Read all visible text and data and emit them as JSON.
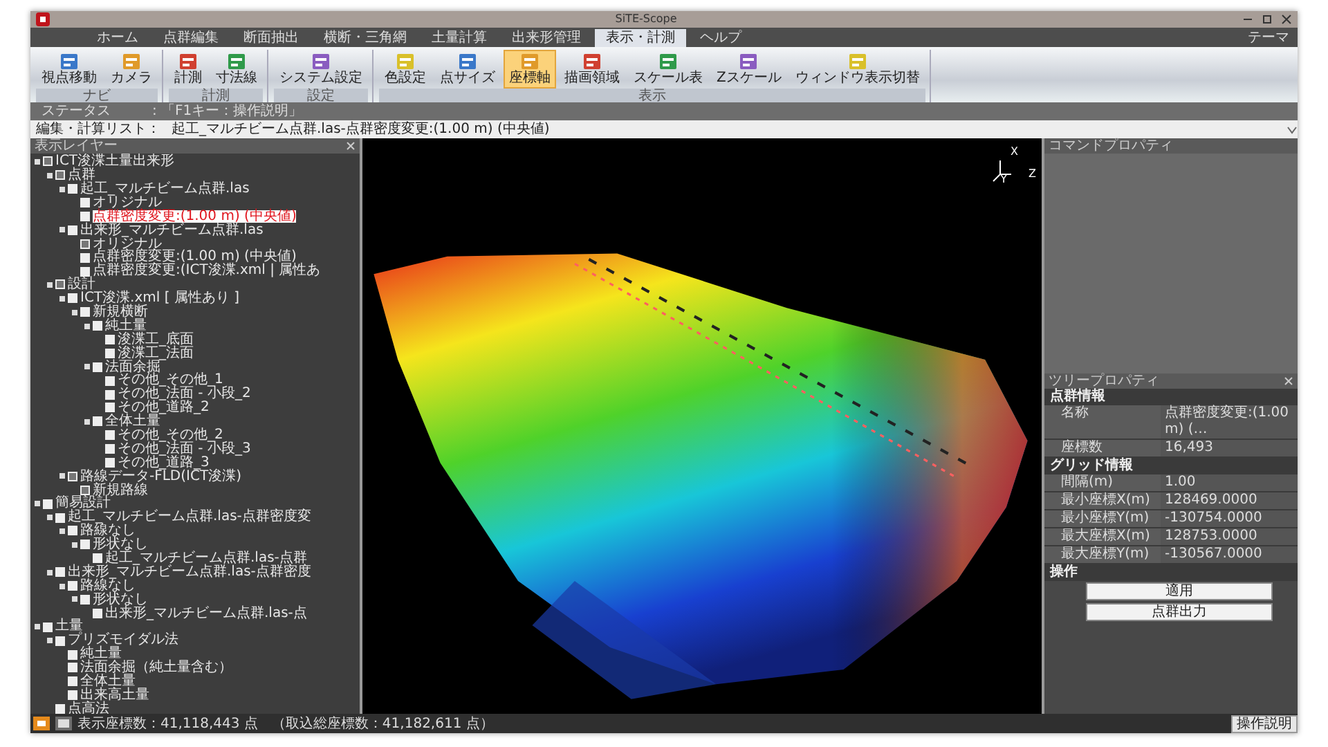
{
  "window": {
    "title": "SiTE-Scope"
  },
  "menu_tabs": [
    {
      "label": "ホーム",
      "selected": false
    },
    {
      "label": "点群編集",
      "selected": false
    },
    {
      "label": "断面抽出",
      "selected": false
    },
    {
      "label": "横断・三角網",
      "selected": false
    },
    {
      "label": "土量計算",
      "selected": false
    },
    {
      "label": "出来形管理",
      "selected": false
    },
    {
      "label": "表示・計測",
      "selected": true
    },
    {
      "label": "ヘルプ",
      "selected": false
    }
  ],
  "theme_menu": "テーマ",
  "ribbon": {
    "groups": [
      {
        "label": "ナビ",
        "buttons": [
          {
            "label": "視点移動",
            "selected": false
          },
          {
            "label": "カメラ",
            "selected": false
          }
        ]
      },
      {
        "label": "計測",
        "buttons": [
          {
            "label": "計測",
            "selected": false
          },
          {
            "label": "寸法線",
            "selected": false
          }
        ]
      },
      {
        "label": "設定",
        "buttons": [
          {
            "label": "システム設定",
            "selected": false
          }
        ]
      },
      {
        "label": "表示",
        "buttons": [
          {
            "label": "色設定",
            "selected": false
          },
          {
            "label": "点サイズ",
            "selected": false
          },
          {
            "label": "座標軸",
            "selected": true
          },
          {
            "label": "描画領域",
            "selected": false
          },
          {
            "label": "スケール表",
            "selected": false
          },
          {
            "label": "Zスケール",
            "selected": false
          },
          {
            "label": "ウィンドウ表示切替",
            "selected": false
          }
        ]
      }
    ]
  },
  "status": {
    "label": "ステータス",
    "text": ":  「F1キー：操作説明」"
  },
  "edit_list": {
    "label": "編集・計算リスト：",
    "value": "起工_マルチビーム点群.las-点群密度変更:(1.00 m) (中央値)"
  },
  "layer_panel": {
    "title": "表示レイヤー",
    "tree": [
      {
        "label": "ICT浚渫土量出来形",
        "checked": true,
        "selected": false,
        "children": [
          {
            "label": "点群",
            "checked": true,
            "selected": false,
            "children": [
              {
                "label": "起工_マルチビーム点群.las",
                "checked": false,
                "selected": false,
                "children": [
                  {
                    "label": "オリジナル",
                    "checked": false,
                    "selected": false
                  },
                  {
                    "label": "点群密度変更:(1.00 m) (中央値)",
                    "checked": false,
                    "selected": true
                  }
                ]
              },
              {
                "label": "出来形_マルチビーム点群.las",
                "checked": false,
                "selected": false,
                "children": [
                  {
                    "label": "オリジナル",
                    "checked": true,
                    "selected": false
                  },
                  {
                    "label": "点群密度変更:(1.00 m) (中央値)",
                    "checked": false,
                    "selected": false
                  },
                  {
                    "label": "点群密度変更:(ICT浚渫.xml | 属性あ",
                    "checked": false,
                    "selected": false
                  }
                ]
              }
            ]
          },
          {
            "label": "設計",
            "checked": true,
            "selected": false,
            "children": [
              {
                "label": "ICT浚渫.xml [ 属性あり ]",
                "checked": false,
                "selected": false,
                "children": [
                  {
                    "label": "新規横断",
                    "checked": false,
                    "selected": false,
                    "children": [
                      {
                        "label": "純土量",
                        "checked": false,
                        "selected": false,
                        "children": [
                          {
                            "label": "浚渫工_底面",
                            "checked": false,
                            "selected": false
                          },
                          {
                            "label": "浚渫工_法面",
                            "checked": false,
                            "selected": false
                          }
                        ]
                      },
                      {
                        "label": "法面余掘",
                        "checked": false,
                        "selected": false,
                        "children": [
                          {
                            "label": "その他_その他_1",
                            "checked": false,
                            "selected": false
                          },
                          {
                            "label": "その他_法面 - 小段_2",
                            "checked": false,
                            "selected": false
                          },
                          {
                            "label": "その他_道路_2",
                            "checked": false,
                            "selected": false
                          }
                        ]
                      },
                      {
                        "label": "全体土量",
                        "checked": false,
                        "selected": false,
                        "children": [
                          {
                            "label": "その他_その他_2",
                            "checked": false,
                            "selected": false
                          },
                          {
                            "label": "その他_法面 - 小段_3",
                            "checked": false,
                            "selected": false
                          },
                          {
                            "label": "その他_道路_3",
                            "checked": false,
                            "selected": false
                          }
                        ]
                      }
                    ]
                  }
                ]
              },
              {
                "label": "路線データ-FLD(ICT浚渫)",
                "checked": true,
                "selected": false,
                "children": [
                  {
                    "label": "新規路線",
                    "checked": true,
                    "selected": false
                  }
                ]
              }
            ]
          }
        ]
      },
      {
        "label": "簡易設計",
        "checked": false,
        "selected": false,
        "children": [
          {
            "label": "起工_マルチビーム点群.las-点群密度変",
            "checked": false,
            "selected": false,
            "children": [
              {
                "label": "路線なし",
                "checked": false,
                "selected": false,
                "children": [
                  {
                    "label": "形状なし",
                    "checked": false,
                    "selected": false,
                    "children": [
                      {
                        "label": "起工_マルチビーム点群.las-点群",
                        "checked": false,
                        "selected": false
                      }
                    ]
                  }
                ]
              }
            ]
          },
          {
            "label": "出来形_マルチビーム点群.las-点群密度",
            "checked": false,
            "selected": false,
            "children": [
              {
                "label": "路線なし",
                "checked": false,
                "selected": false,
                "children": [
                  {
                    "label": "形状なし",
                    "checked": false,
                    "selected": false,
                    "children": [
                      {
                        "label": "出来形_マルチビーム点群.las-点",
                        "checked": false,
                        "selected": false
                      }
                    ]
                  }
                ]
              }
            ]
          }
        ]
      },
      {
        "label": "土量",
        "checked": false,
        "selected": false,
        "children": [
          {
            "label": "プリズモイダル法",
            "checked": false,
            "selected": false,
            "children": [
              {
                "label": "純土量",
                "checked": false,
                "selected": false
              },
              {
                "label": "法面余掘（純土量含む）",
                "checked": false,
                "selected": false
              },
              {
                "label": "全体土量",
                "checked": false,
                "selected": false
              },
              {
                "label": "出来高土量",
                "checked": false,
                "selected": false
              }
            ]
          },
          {
            "label": "点高法",
            "checked": false,
            "selected": false
          }
        ]
      }
    ]
  },
  "viewport": {
    "axis_labels": [
      "Z",
      "X",
      "Y"
    ]
  },
  "command_panel": {
    "title": "コマンドプロパティ"
  },
  "tree_property_panel": {
    "title": "ツリープロパティ",
    "sections": [
      {
        "title": "点群情報",
        "rows": [
          {
            "label": "名称",
            "value": "点群密度変更:(1.00 m) (…"
          },
          {
            "label": "座標数",
            "value": "16,493"
          }
        ]
      },
      {
        "title": "グリッド情報",
        "rows": [
          {
            "label": "間隔(m)",
            "value": "1.00"
          },
          {
            "label": "最小座標X(m)",
            "value": "128469.0000"
          },
          {
            "label": "最小座標Y(m)",
            "value": "-130754.0000"
          },
          {
            "label": "最大座標X(m)",
            "value": "128753.0000"
          },
          {
            "label": "最大座標Y(m)",
            "value": "-130567.0000"
          }
        ]
      },
      {
        "title": "操作",
        "buttons": [
          "適用",
          "点群出力"
        ]
      }
    ]
  },
  "status_bar": {
    "text": "表示座標数：41,118,443 点　（取込総座標数：41,182,611 点）",
    "help_button": "操作説明"
  }
}
